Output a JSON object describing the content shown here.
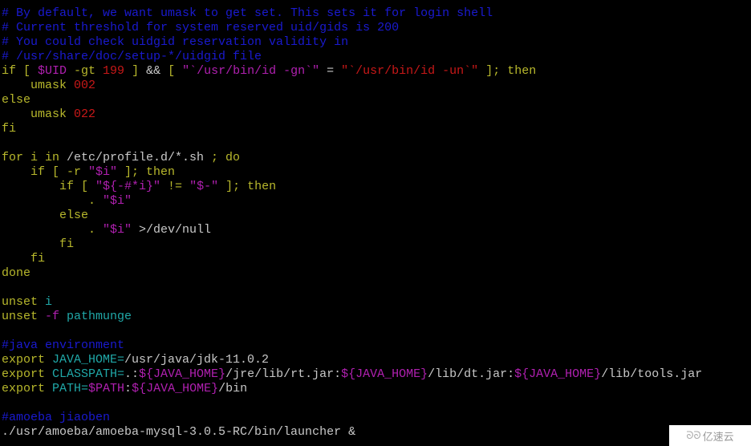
{
  "terminal": {
    "lines": [
      [
        {
          "t": "# By default, we want umask to get set. This sets it for login shell",
          "c": "comment"
        }
      ],
      [
        {
          "t": "# Current threshold for system reserved uid/gids is 200",
          "c": "comment"
        }
      ],
      [
        {
          "t": "# You could check uidgid reservation validity in",
          "c": "comment"
        }
      ],
      [
        {
          "t": "# /usr/share/doc/setup-*/uidgid file",
          "c": "comment"
        }
      ],
      [
        {
          "t": "if [ ",
          "c": "kw"
        },
        {
          "t": "$UID",
          "c": "var"
        },
        {
          "t": " -gt ",
          "c": "kw"
        },
        {
          "t": "199",
          "c": "num"
        },
        {
          "t": " ] ",
          "c": "kw"
        },
        {
          "t": "&&",
          "c": "plain"
        },
        {
          "t": " [ ",
          "c": "kw"
        },
        {
          "t": "\"`/usr/bin/id -gn`\"",
          "c": "var"
        },
        {
          "t": " = ",
          "c": "plain"
        },
        {
          "t": "\"`/usr/bin/id -un`\"",
          "c": "str"
        },
        {
          "t": " ]; then",
          "c": "kw"
        }
      ],
      [
        {
          "t": "    umask ",
          "c": "kw"
        },
        {
          "t": "002",
          "c": "num"
        }
      ],
      [
        {
          "t": "else",
          "c": "kw"
        }
      ],
      [
        {
          "t": "    umask ",
          "c": "kw"
        },
        {
          "t": "022",
          "c": "num"
        }
      ],
      [
        {
          "t": "fi",
          "c": "kw"
        }
      ],
      [
        {
          "t": "",
          "c": "plain"
        }
      ],
      [
        {
          "t": "for i in ",
          "c": "kw"
        },
        {
          "t": "/etc/profile.d/*.sh",
          "c": "plain"
        },
        {
          "t": " ; do",
          "c": "kw"
        }
      ],
      [
        {
          "t": "    if [ -r ",
          "c": "kw"
        },
        {
          "t": "\"$i\"",
          "c": "var"
        },
        {
          "t": " ]; then",
          "c": "kw"
        }
      ],
      [
        {
          "t": "        if [ ",
          "c": "kw"
        },
        {
          "t": "\"${-#*i}\"",
          "c": "var"
        },
        {
          "t": " != ",
          "c": "kw"
        },
        {
          "t": "\"$-\"",
          "c": "var"
        },
        {
          "t": " ]; then",
          "c": "kw"
        }
      ],
      [
        {
          "t": "            . ",
          "c": "kw"
        },
        {
          "t": "\"$i\"",
          "c": "var"
        }
      ],
      [
        {
          "t": "        else",
          "c": "kw"
        }
      ],
      [
        {
          "t": "            . ",
          "c": "kw"
        },
        {
          "t": "\"$i\"",
          "c": "var"
        },
        {
          "t": " >/dev/null",
          "c": "plain"
        }
      ],
      [
        {
          "t": "        fi",
          "c": "kw"
        }
      ],
      [
        {
          "t": "    fi",
          "c": "kw"
        }
      ],
      [
        {
          "t": "done",
          "c": "kw"
        }
      ],
      [
        {
          "t": "",
          "c": "plain"
        }
      ],
      [
        {
          "t": "unset ",
          "c": "kw"
        },
        {
          "t": "i",
          "c": "id"
        }
      ],
      [
        {
          "t": "unset ",
          "c": "kw"
        },
        {
          "t": "-f",
          "c": "var"
        },
        {
          "t": " pathmunge",
          "c": "id"
        }
      ],
      [
        {
          "t": "",
          "c": "plain"
        }
      ],
      [
        {
          "t": "#java environment",
          "c": "comment"
        }
      ],
      [
        {
          "t": "export ",
          "c": "kw"
        },
        {
          "t": "JAVA_HOME=",
          "c": "id"
        },
        {
          "t": "/usr/java/jdk-11.0.2",
          "c": "plain"
        }
      ],
      [
        {
          "t": "export ",
          "c": "kw"
        },
        {
          "t": "CLASSPATH=",
          "c": "id"
        },
        {
          "t": ".:",
          "c": "plain"
        },
        {
          "t": "${JAVA_HOME}",
          "c": "var"
        },
        {
          "t": "/jre/lib/rt.jar:",
          "c": "plain"
        },
        {
          "t": "${JAVA_HOME}",
          "c": "var"
        },
        {
          "t": "/lib/dt.jar:",
          "c": "plain"
        },
        {
          "t": "${JAVA_HOME}",
          "c": "var"
        },
        {
          "t": "/lib/tools.jar",
          "c": "plain"
        }
      ],
      [
        {
          "t": "export ",
          "c": "kw"
        },
        {
          "t": "PATH=",
          "c": "id"
        },
        {
          "t": "$PATH",
          "c": "var"
        },
        {
          "t": ":",
          "c": "plain"
        },
        {
          "t": "${JAVA_HOME}",
          "c": "var"
        },
        {
          "t": "/bin",
          "c": "plain"
        }
      ],
      [
        {
          "t": "",
          "c": "plain"
        }
      ],
      [
        {
          "t": "#amoeba jiaoben",
          "c": "comment"
        }
      ],
      [
        {
          "t": "./usr/amoeba/amoeba-mysql-3.0.5-RC/bin/launcher &",
          "c": "plain"
        }
      ]
    ]
  },
  "watermark": {
    "logo_icon": "cloud-logo-icon",
    "logo_glyph": "ᘐᘐ",
    "text": "亿速云"
  }
}
